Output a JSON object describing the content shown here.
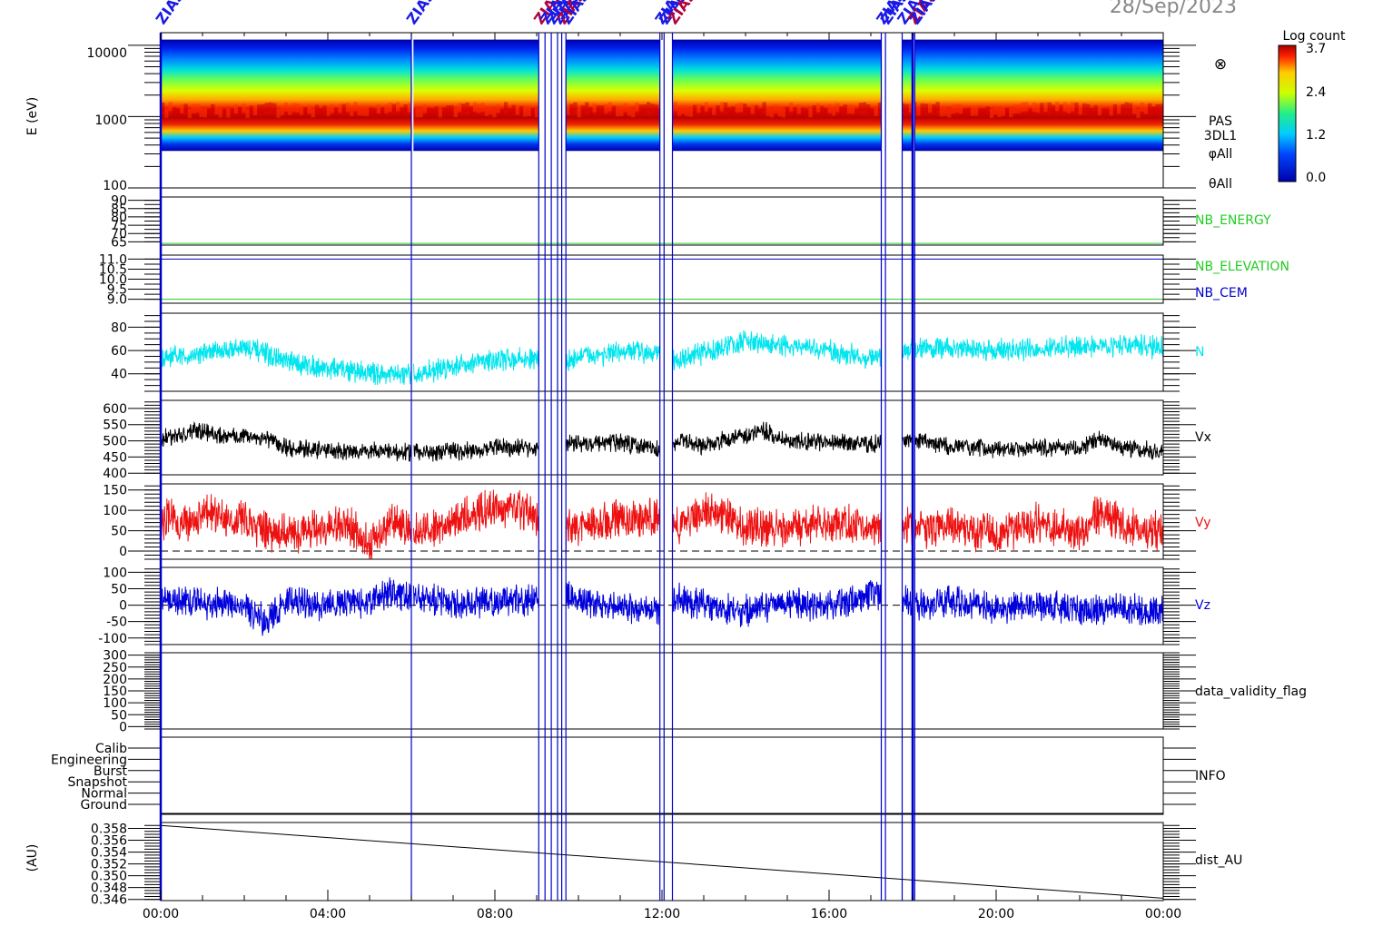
{
  "date_label": "28/Sep/2023",
  "time_axis": {
    "ticks": [
      "00:00",
      "04:00",
      "08:00",
      "12:00",
      "16:00",
      "20:00",
      "00:00"
    ],
    "range_hours": [
      0,
      24
    ]
  },
  "colors": {
    "frame": "#000000",
    "event_line": "#0000cc",
    "event_label": "#1a1ae6",
    "event_label_alt": "#b3003c",
    "nb_green": "#22cc22",
    "nb_blue": "#0000cc",
    "density": "#00e5ee",
    "vx": "#000000",
    "vy": "#ee1111",
    "vz": "#0000dd"
  },
  "event_markers": {
    "label": "ZIAS",
    "times_hours": [
      0.0,
      6.0,
      9.05,
      9.2,
      9.35,
      9.5,
      9.6,
      9.7,
      11.95,
      12.05,
      12.25,
      17.25,
      17.35,
      17.75,
      18.0,
      18.05
    ]
  },
  "colorbar": {
    "title": "Log count",
    "ticks": [
      "3.7",
      "2.4",
      "1.2",
      "0.0"
    ],
    "range": [
      0.0,
      3.7
    ]
  },
  "chart_data": [
    {
      "type": "heatmap",
      "panel": "spectrogram",
      "ylabel": "E (eV)",
      "y_scale": "log",
      "ylim": [
        100,
        15000
      ],
      "yticks": [
        "10000",
        "1000",
        "100"
      ],
      "right_labels": [
        "PAS",
        "3DL1",
        "φAll",
        "θAll"
      ],
      "symbol": "⊗",
      "energy_low_bound_eV": 330,
      "energy_high_bound_eV": 12000,
      "peak_energy_eV": 1200,
      "gaps_hours": [
        [
          6.0,
          6.05
        ],
        [
          9.05,
          9.7
        ],
        [
          11.95,
          12.25
        ],
        [
          17.25,
          17.75
        ],
        [
          18.0,
          18.05
        ]
      ]
    },
    {
      "type": "line",
      "panel": "nb_energy",
      "yticks": [
        "90",
        "85",
        "80",
        "75",
        "70",
        "65"
      ],
      "ylim": [
        63,
        92
      ],
      "series": [
        {
          "name": "NB_ENERGY",
          "value": 64
        }
      ]
    },
    {
      "type": "line",
      "panel": "nb_elevation_cem",
      "yticks": [
        "11.0",
        "10.5",
        "10.0",
        "9.5",
        "9.0"
      ],
      "ylim": [
        8.8,
        11.2
      ],
      "series": [
        {
          "name": "NB_ELEVATION",
          "value": 9.0
        },
        {
          "name": "NB_CEM",
          "value": 11.0
        }
      ]
    },
    {
      "type": "line",
      "panel": "density",
      "yticks": [
        "80",
        "60",
        "40"
      ],
      "ylim": [
        25,
        92
      ],
      "series": [
        {
          "name": "N",
          "x": [
            0,
            1,
            2,
            2.5,
            3,
            4,
            5,
            6,
            7,
            8,
            9,
            9.5,
            10,
            11,
            11.9,
            12.3,
            13,
            14,
            15,
            16,
            17,
            18,
            19,
            20,
            21,
            22,
            23,
            24
          ],
          "y": [
            52,
            58,
            63,
            57,
            50,
            45,
            41,
            38,
            47,
            52,
            53,
            46,
            55,
            58,
            60,
            50,
            58,
            68,
            63,
            60,
            53,
            62,
            62,
            60,
            61,
            63,
            65,
            62
          ]
        }
      ]
    },
    {
      "type": "line",
      "panel": "vx",
      "yticks": [
        "600",
        "550",
        "500",
        "450",
        "400"
      ],
      "ylim": [
        395,
        625
      ],
      "series": [
        {
          "name": "Vx",
          "x": [
            0,
            0.5,
            1,
            1.5,
            2,
            2.5,
            3,
            4,
            5,
            6,
            7,
            8,
            9,
            9.5,
            10,
            11,
            12,
            12.5,
            13,
            14,
            14.5,
            15,
            16,
            17,
            18,
            19,
            20,
            21,
            22,
            22.5,
            23,
            24
          ],
          "y": [
            505,
            520,
            530,
            515,
            515,
            510,
            480,
            470,
            468,
            465,
            468,
            480,
            478,
            500,
            490,
            495,
            470,
            500,
            485,
            520,
            530,
            500,
            495,
            490,
            505,
            480,
            475,
            478,
            480,
            505,
            480,
            465
          ]
        }
      ]
    },
    {
      "type": "line",
      "panel": "vy",
      "yticks": [
        "150",
        "100",
        "50",
        "0"
      ],
      "ylim": [
        -20,
        165
      ],
      "zero_line": true,
      "series": [
        {
          "name": "Vy",
          "x": [
            0,
            0.5,
            1,
            2,
            2.5,
            3,
            4,
            4.5,
            5,
            5.5,
            6,
            7,
            7.5,
            8,
            9,
            9.5,
            10,
            11,
            11.9,
            12.3,
            13,
            13.5,
            14,
            15,
            16,
            17,
            17.5,
            18,
            19,
            20,
            21,
            22,
            22.5,
            23,
            24
          ],
          "y": [
            80,
            70,
            90,
            80,
            50,
            40,
            60,
            70,
            10,
            70,
            40,
            70,
            90,
            110,
            90,
            40,
            60,
            80,
            80,
            60,
            100,
            90,
            60,
            55,
            70,
            60,
            80,
            50,
            60,
            40,
            70,
            40,
            100,
            60,
            50
          ]
        }
      ]
    },
    {
      "type": "line",
      "panel": "vz",
      "yticks": [
        "100",
        "50",
        "0",
        "-50",
        "-100"
      ],
      "ylim": [
        -120,
        115
      ],
      "zero_line": true,
      "series": [
        {
          "name": "Vz",
          "x": [
            0,
            1,
            2,
            2.5,
            3,
            4,
            5,
            5.5,
            6,
            7,
            8,
            9,
            9.5,
            10,
            11,
            11.9,
            12.3,
            13,
            14,
            15,
            16,
            17,
            18,
            19,
            20,
            21,
            22,
            23,
            24
          ],
          "y": [
            20,
            10,
            -10,
            -50,
            10,
            5,
            15,
            35,
            25,
            5,
            10,
            20,
            45,
            10,
            -10,
            -20,
            20,
            5,
            -20,
            10,
            -5,
            40,
            0,
            10,
            -10,
            0,
            -15,
            -10,
            -20
          ]
        }
      ]
    },
    {
      "type": "line",
      "panel": "data_validity_flag",
      "yticks": [
        "300",
        "250",
        "200",
        "150",
        "100",
        "50",
        "0"
      ],
      "ylim": [
        -10,
        310
      ],
      "series": [
        {
          "name": "data_validity_flag",
          "value": 0
        }
      ]
    },
    {
      "type": "line",
      "panel": "info",
      "yticks": [
        "Calib",
        "Engineering",
        "Burst",
        "Snapshot",
        "Normal",
        "Ground"
      ],
      "series": [
        {
          "name": "INFO",
          "value": "Ground"
        }
      ]
    },
    {
      "type": "line",
      "panel": "dist_au",
      "ylabel": "(AU)",
      "yticks": [
        "0.358",
        "0.356",
        "0.354",
        "0.352",
        "0.350",
        "0.348",
        "0.346"
      ],
      "ylim": [
        0.3458,
        0.359
      ],
      "series": [
        {
          "name": "dist_AU",
          "x": [
            0,
            24
          ],
          "y": [
            0.3585,
            0.3462
          ]
        }
      ]
    }
  ]
}
